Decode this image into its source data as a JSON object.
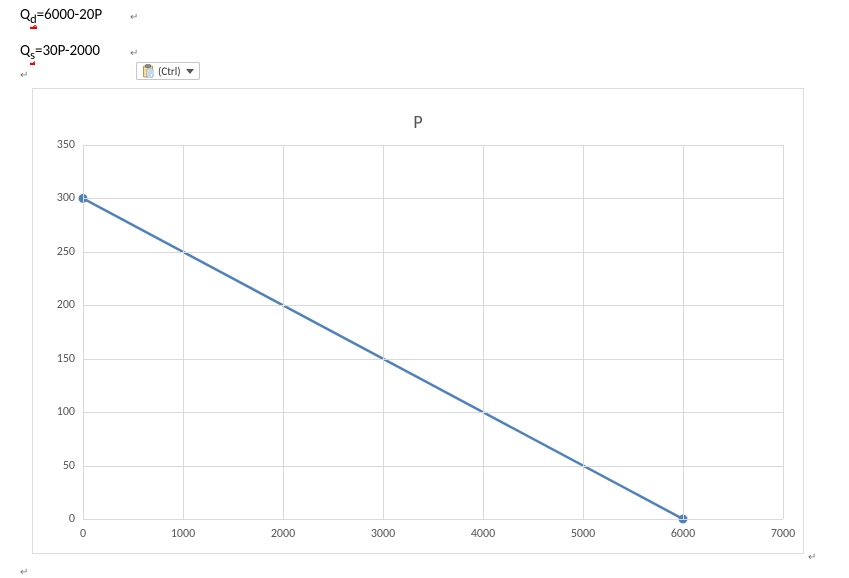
{
  "doc": {
    "equation1_pre": "Q",
    "equation1_sub": "d",
    "equation1_rest": "=6000-20P",
    "equation2_pre": "Q",
    "equation2_sub": "s",
    "equation2_rest": "=30P-2000",
    "return_glyph": "↵"
  },
  "paste_pill": {
    "label": "(Ctrl)"
  },
  "chart_data": {
    "type": "line",
    "title": "P",
    "x": [
      0,
      6000
    ],
    "values": [
      300,
      0
    ],
    "xlim": [
      0,
      7000
    ],
    "ylim": [
      0,
      350
    ],
    "x_ticks": [
      0,
      1000,
      2000,
      3000,
      4000,
      5000,
      6000,
      7000
    ],
    "y_ticks": [
      0,
      50,
      100,
      150,
      200,
      250,
      300,
      350
    ],
    "marker_color": "#4f81bd",
    "line_color": "#4f81bd"
  }
}
